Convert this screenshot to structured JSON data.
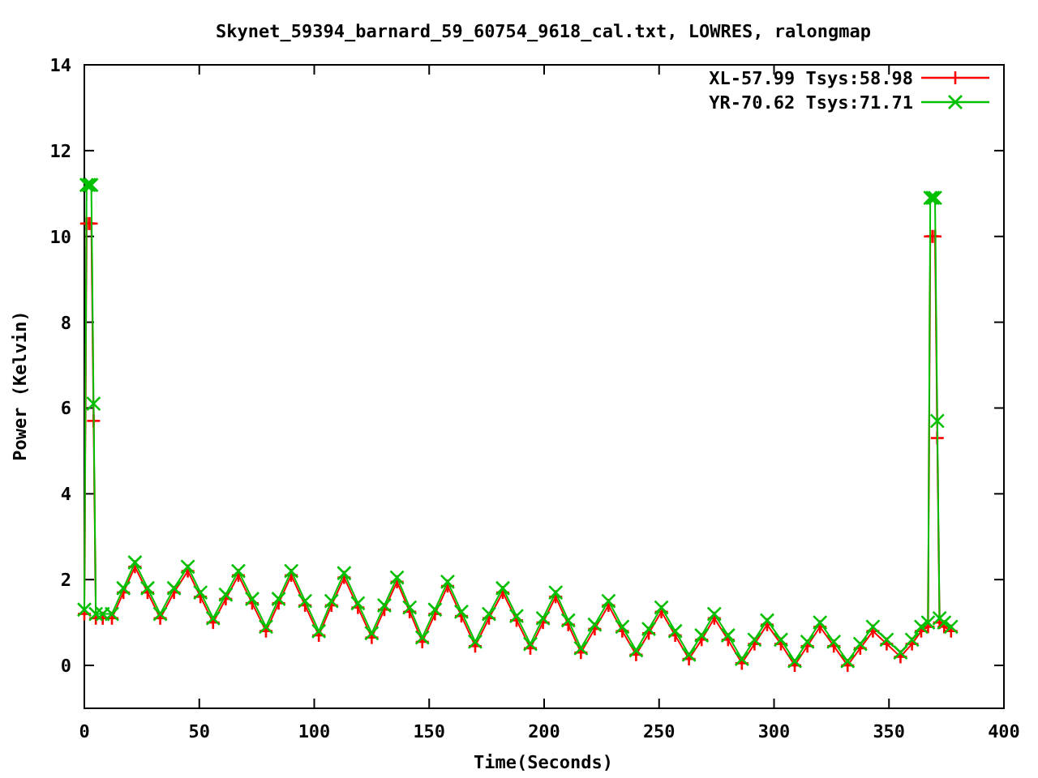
{
  "chart_data": {
    "type": "line",
    "title": "Skynet_59394_barnard_59_60754_9618_cal.txt, LOWRES, ralongmap",
    "xlabel": "Time(Seconds)",
    "ylabel": "Power (Kelvin)",
    "x": [
      0,
      1,
      2,
      3,
      4,
      5,
      8,
      12,
      17,
      22,
      27.5,
      33,
      39,
      45,
      50.5,
      56,
      61.5,
      67,
      73,
      79,
      84.5,
      90,
      96,
      102,
      107.5,
      113,
      119,
      125,
      130.5,
      136,
      141.5,
      147,
      152.5,
      158,
      164,
      170,
      176,
      182,
      188,
      194,
      199.5,
      205,
      210.5,
      216,
      222,
      228,
      234,
      240,
      245.5,
      251,
      257,
      263,
      268.5,
      274,
      280,
      286,
      291.5,
      297,
      303,
      309,
      314.5,
      320,
      326,
      332,
      337.5,
      343,
      349,
      355,
      360,
      364,
      367,
      368,
      369,
      370,
      371,
      372,
      374,
      377
    ],
    "series": [
      {
        "name": "XL-57.99 Tsys:58.98",
        "color": "#ff0000",
        "marker": "plus",
        "values": [
          1.2,
          10.3,
          10.3,
          10.3,
          5.7,
          1.1,
          1.1,
          1.1,
          1.7,
          2.3,
          1.7,
          1.1,
          1.7,
          2.2,
          1.6,
          1.0,
          1.55,
          2.1,
          1.45,
          0.8,
          1.45,
          2.1,
          1.4,
          0.7,
          1.4,
          2.05,
          1.35,
          0.65,
          1.3,
          1.95,
          1.25,
          0.55,
          1.2,
          1.85,
          1.15,
          0.45,
          1.1,
          1.7,
          1.05,
          0.4,
          1.0,
          1.6,
          0.95,
          0.3,
          0.85,
          1.4,
          0.8,
          0.25,
          0.75,
          1.25,
          0.7,
          0.15,
          0.6,
          1.1,
          0.6,
          0.05,
          0.5,
          0.95,
          0.5,
          0.0,
          0.45,
          0.9,
          0.45,
          0.0,
          0.4,
          0.8,
          0.5,
          0.2,
          0.5,
          0.8,
          0.9,
          10.0,
          10.0,
          10.0,
          5.3,
          1.0,
          0.9,
          0.8
        ]
      },
      {
        "name": "YR-70.62 Tsys:71.71",
        "color": "#00c000",
        "marker": "cross",
        "values": [
          1.3,
          11.2,
          11.2,
          11.2,
          6.1,
          1.2,
          1.2,
          1.2,
          1.8,
          2.4,
          1.8,
          1.2,
          1.8,
          2.3,
          1.7,
          1.1,
          1.65,
          2.2,
          1.55,
          0.9,
          1.55,
          2.2,
          1.5,
          0.8,
          1.5,
          2.15,
          1.45,
          0.75,
          1.4,
          2.05,
          1.35,
          0.65,
          1.3,
          1.95,
          1.25,
          0.55,
          1.2,
          1.8,
          1.15,
          0.5,
          1.1,
          1.7,
          1.05,
          0.4,
          0.95,
          1.5,
          0.9,
          0.35,
          0.85,
          1.35,
          0.8,
          0.25,
          0.7,
          1.2,
          0.7,
          0.15,
          0.6,
          1.05,
          0.6,
          0.1,
          0.55,
          1.0,
          0.55,
          0.1,
          0.5,
          0.9,
          0.6,
          0.3,
          0.6,
          0.9,
          1.0,
          10.9,
          10.9,
          10.9,
          5.7,
          1.1,
          1.0,
          0.9
        ]
      }
    ],
    "legend": true,
    "xlim": [
      0,
      400
    ],
    "ylim": [
      -1,
      14
    ],
    "xticks": [
      0,
      50,
      100,
      150,
      200,
      250,
      300,
      350,
      400
    ],
    "yticks": [
      0,
      2,
      4,
      6,
      8,
      10,
      12,
      14
    ]
  }
}
